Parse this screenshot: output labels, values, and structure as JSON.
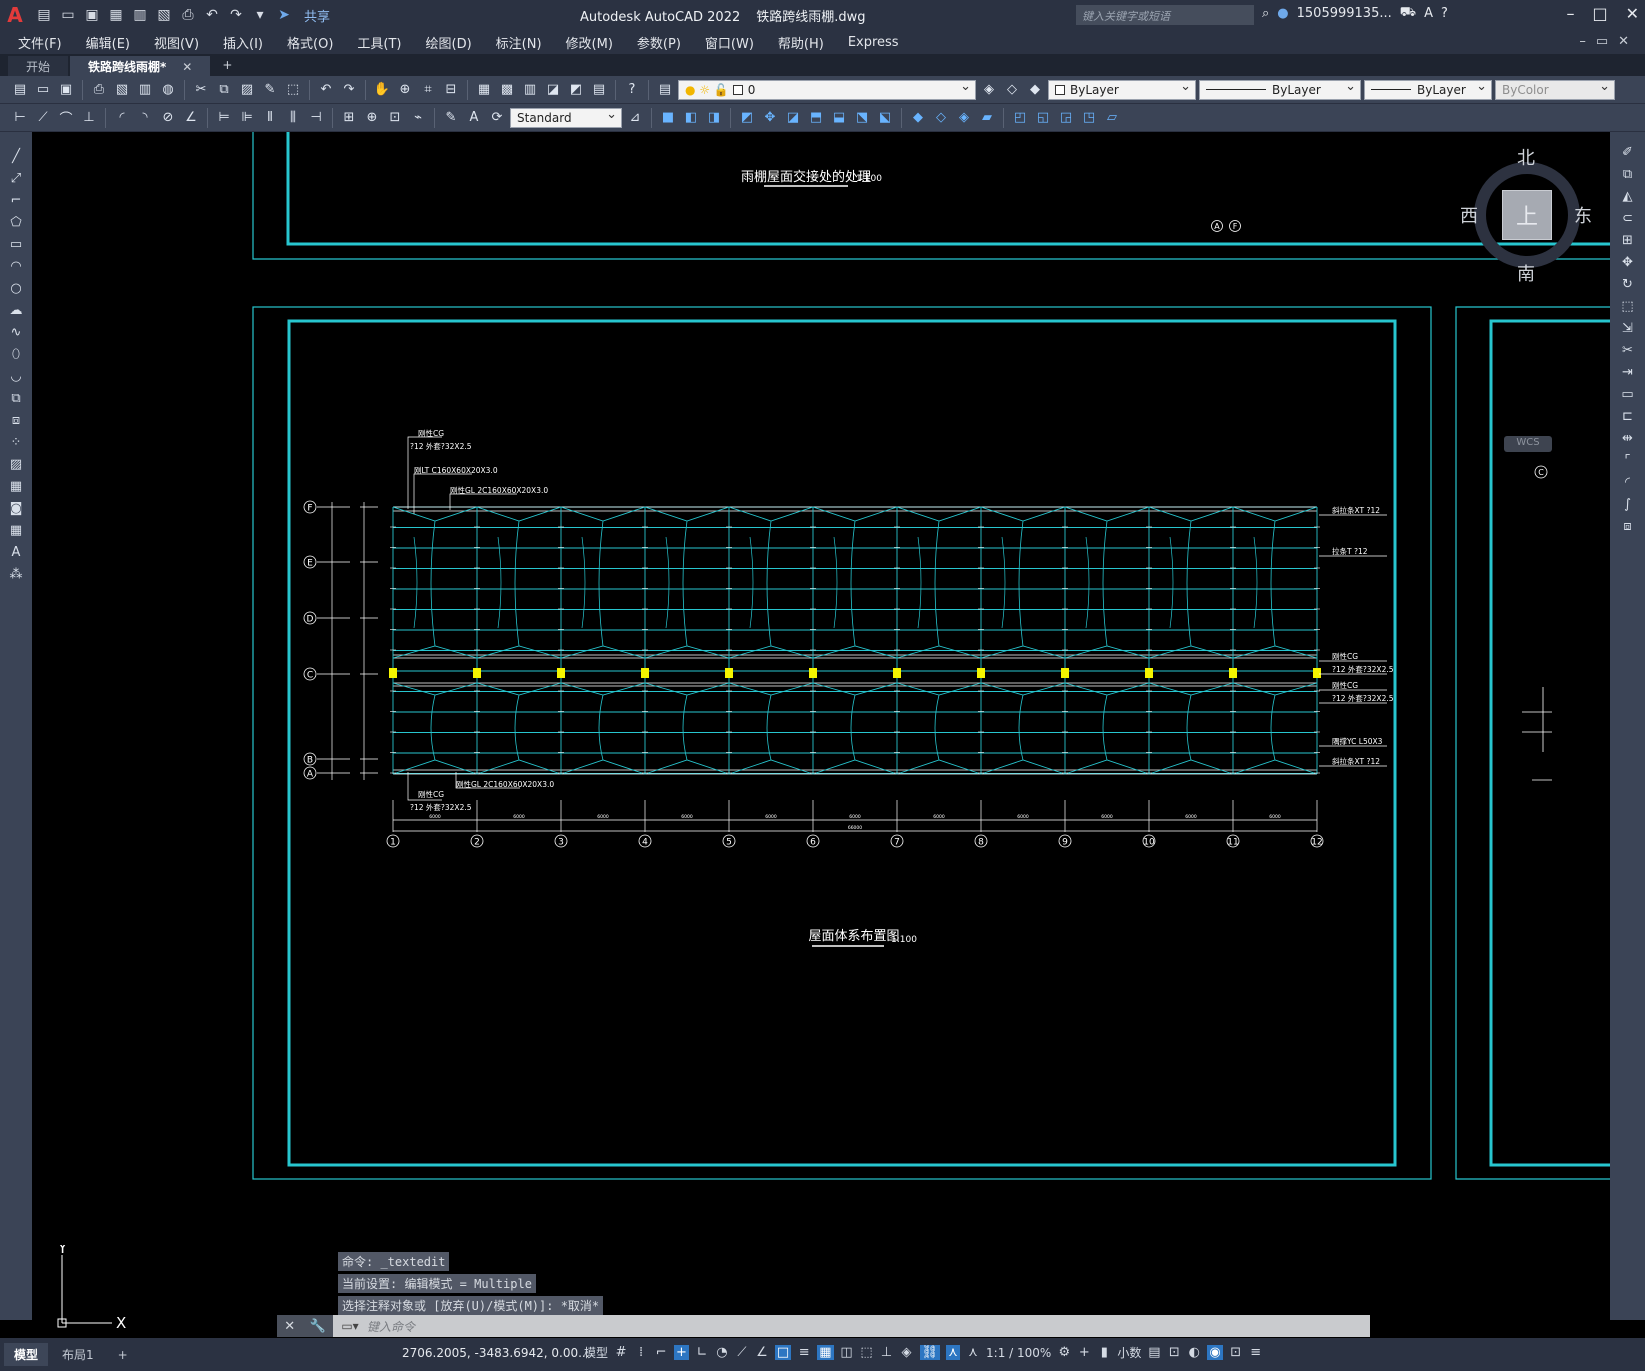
{
  "window": {
    "app_title": "Autodesk AutoCAD 2022",
    "file_name": "铁路跨线雨棚.dwg",
    "search_placeholder": "键入关键字或短语",
    "user": "1505999135...",
    "share_label": "共享"
  },
  "menu": [
    "文件(F)",
    "编辑(E)",
    "视图(V)",
    "插入(I)",
    "格式(O)",
    "工具(T)",
    "绘图(D)",
    "标注(N)",
    "修改(M)",
    "参数(P)",
    "窗口(W)",
    "帮助(H)",
    "Express"
  ],
  "tabs": {
    "start": "开始",
    "active": "铁路跨线雨棚*"
  },
  "properties": {
    "layer": "0",
    "color": "ByLayer",
    "linetype": "ByLayer",
    "lineweight": "ByLayer",
    "plotstyle": "ByColor",
    "text_style": "Standard"
  },
  "viewcube": {
    "north": "北",
    "south": "南",
    "east": "东",
    "west": "西",
    "face": "上",
    "wcs": "WCS"
  },
  "drawing": {
    "top_title": "雨棚屋面交接处的处理",
    "top_scale": "1:100",
    "top_axis_labels": [
      "A",
      "F"
    ],
    "main_title": "屋面体系布置图",
    "main_scale": "1:100",
    "row_axes": [
      "F",
      "E",
      "D",
      "C",
      "B",
      "A"
    ],
    "col_axes": [
      "1",
      "2",
      "3",
      "4",
      "5",
      "6",
      "7",
      "8",
      "9",
      "10",
      "11",
      "12"
    ],
    "right_side_label": "C",
    "annotations_left": {
      "top_cg": "刚性CG",
      "top_cg_spec": "?12 外套?32X2.5",
      "lt": "刚LT C160X60X20X3.0",
      "gl_top": "刚性GL 2C160X60X20X3.0",
      "gl_bottom": "刚性GL 2C160X60X20X3.0",
      "bottom_cg": "刚性CG",
      "bottom_cg_spec": "?12 外套?32X2.5"
    },
    "annotations_right": [
      "斜拉条XT ?12",
      "拉条T ?12",
      "刚性CG",
      "?12 外套?32X2.5",
      "刚性CG",
      "?12 外套?32X2.5",
      "隅撑YC L50X3",
      "斜拉条XT ?12"
    ],
    "bay_dims": [
      "6000",
      "6000",
      "6000",
      "6000",
      "6000",
      "6000",
      "6000",
      "6000",
      "6000",
      "6000",
      "6000"
    ],
    "total_dim": "66000"
  },
  "command": {
    "history": [
      "命令: _textedit",
      "当前设置: 编辑模式 = Multiple",
      "选择注释对象或 [放弃(U)/模式(M)]: *取消*"
    ],
    "placeholder": "键入命令"
  },
  "status": {
    "model_tab": "模型",
    "layout_tab": "布局1",
    "coords": "2706.2005, -3483.6942, 0.00...",
    "model_label": "模型",
    "scale": "1:1 / 100%",
    "units": "小数"
  }
}
